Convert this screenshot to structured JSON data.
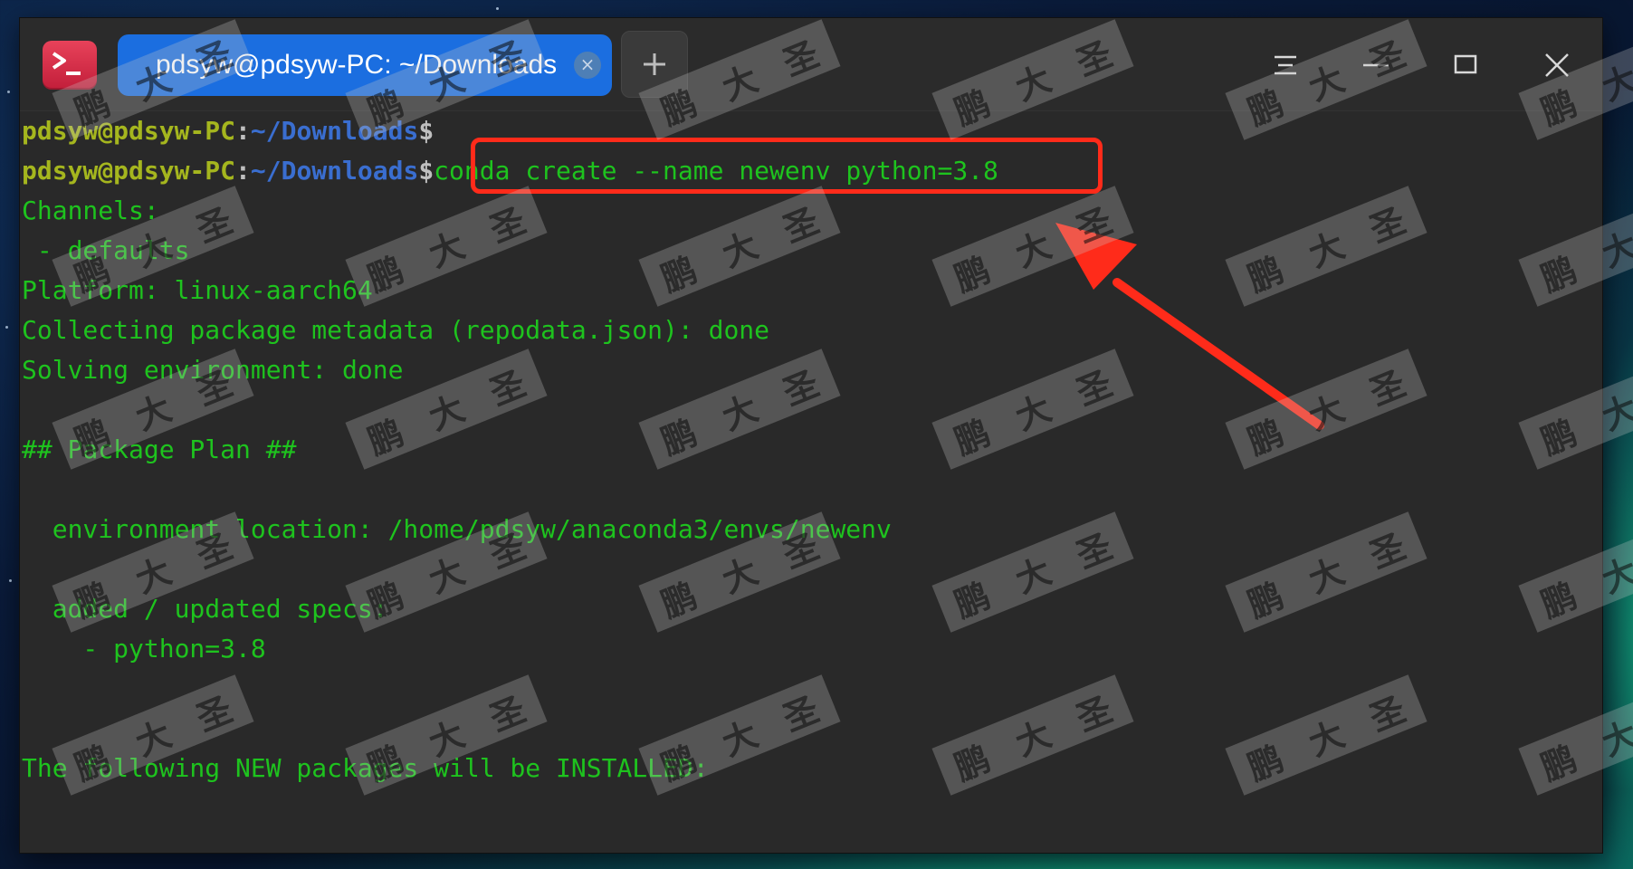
{
  "window": {
    "tab_title": "pdsyw@pdsyw-PC: ~/Downloads",
    "tab_close_glyph": "×",
    "new_tab_icon": "plus-icon",
    "controls": [
      "menu-icon",
      "minimize-icon",
      "maximize-icon",
      "close-icon"
    ]
  },
  "terminal": {
    "prompt1": {
      "user": "pdsyw@pdsyw-PC",
      "colon": ":",
      "path": "~/Downloads",
      "dollar": "$",
      "cmd": ""
    },
    "prompt2": {
      "user": "pdsyw@pdsyw-PC",
      "colon": ":",
      "path": "~/Downloads",
      "dollar": "$",
      "cmd": "conda create --name newenv python=3.8"
    },
    "output": [
      "Channels:",
      " - defaults",
      "Platform: linux-aarch64",
      "Collecting package metadata (repodata.json): done",
      "Solving environment: done",
      "",
      "## Package Plan ##",
      "",
      "  environment location: /home/pdsyw/anaconda3/envs/newenv",
      "",
      "  added / updated specs:",
      "    - python=3.8",
      "",
      "",
      "The following NEW packages will be INSTALLED:"
    ]
  },
  "watermark": {
    "chars": [
      "鹏",
      "大",
      "圣"
    ]
  },
  "colors": {
    "prompt_user": "#a5b61e",
    "prompt_path": "#3a6ed0",
    "output_green": "#1ec31e",
    "terminal_bg": "#292929",
    "tab_active": "#1b6ee0",
    "annotation_red": "#ff2b1a"
  }
}
